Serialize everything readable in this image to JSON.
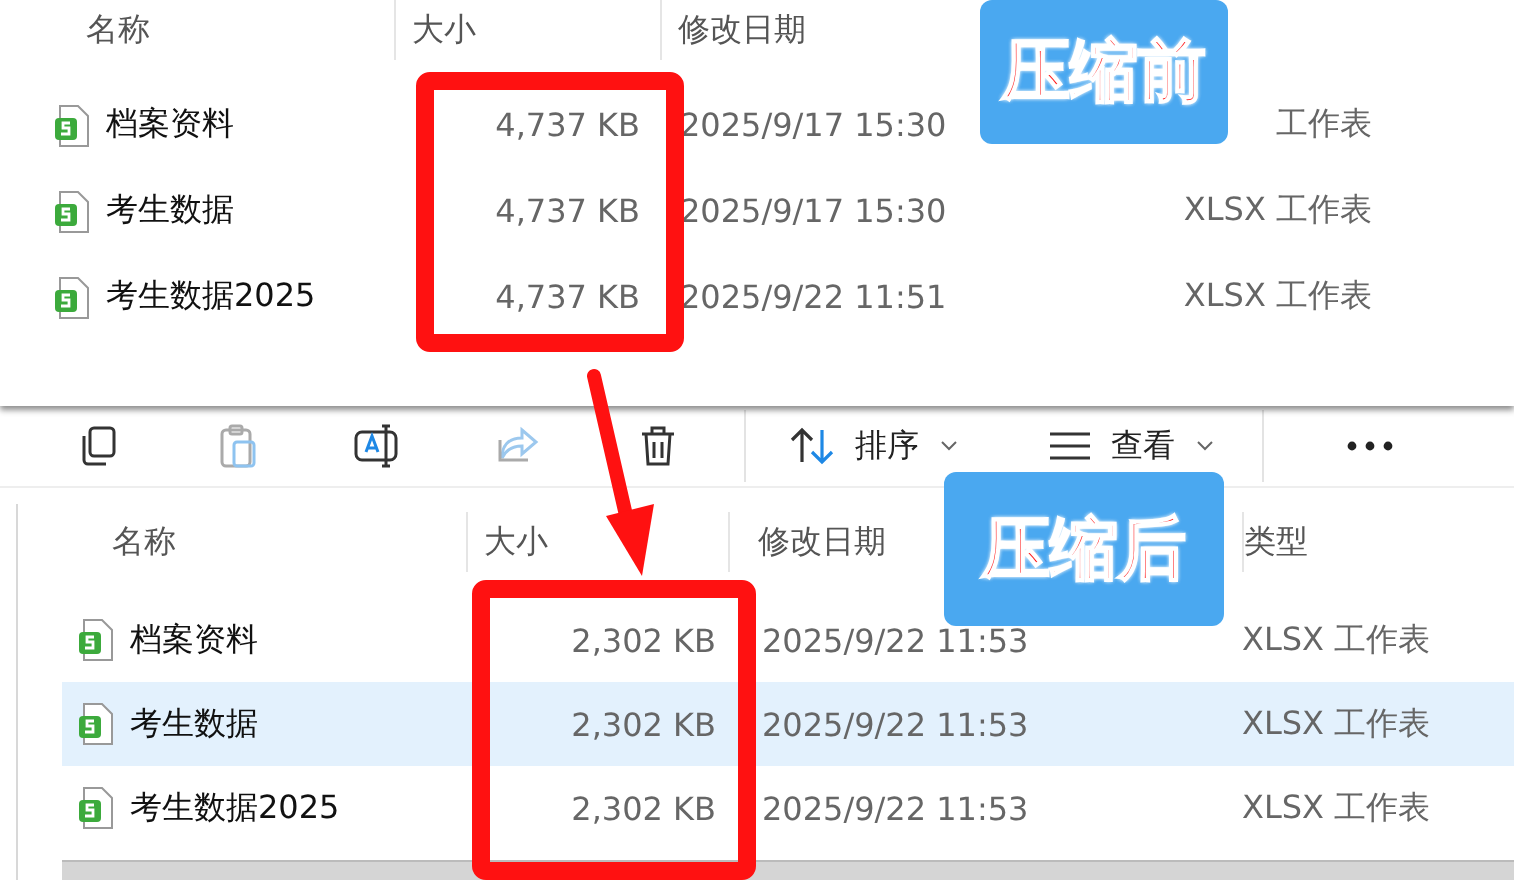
{
  "before": {
    "columns": [
      "名称",
      "大小",
      "修改日期"
    ],
    "rows": [
      {
        "name": "档案资料",
        "size": "4,737 KB",
        "modified": "2025/9/17 15:30",
        "type": "工作表",
        "selected": false
      },
      {
        "name": "考生数据",
        "size": "4,737 KB",
        "modified": "2025/9/17 15:30",
        "type": "XLSX 工作表",
        "selected": false
      },
      {
        "name": "考生数据2025",
        "size": "4,737 KB",
        "modified": "2025/9/22 11:51",
        "type": "XLSX 工作表",
        "selected": false
      }
    ],
    "badge": "压缩前"
  },
  "after": {
    "toolbar": [
      {
        "kind": "copy",
        "disabled": false
      },
      {
        "kind": "paste",
        "disabled": true
      },
      {
        "kind": "rename",
        "disabled": false
      },
      {
        "kind": "share",
        "disabled": true
      },
      {
        "kind": "delete",
        "disabled": false
      },
      {
        "kind": "sort",
        "label": "排序",
        "disabled": false
      },
      {
        "kind": "view",
        "label": "查看",
        "disabled": false
      },
      {
        "kind": "more",
        "disabled": false
      }
    ],
    "columns": [
      "名称",
      "大小",
      "修改日期",
      "类型"
    ],
    "rows": [
      {
        "name": "档案资料",
        "size": "2,302 KB",
        "modified": "2025/9/22 11:53",
        "type": "XLSX 工作表",
        "selected": false
      },
      {
        "name": "考生数据",
        "size": "2,302 KB",
        "modified": "2025/9/22 11:53",
        "type": "XLSX 工作表",
        "selected": true
      },
      {
        "name": "考生数据2025",
        "size": "2,302 KB",
        "modified": "2025/9/22 11:53",
        "type": "XLSX 工作表",
        "selected": false
      }
    ],
    "badge": "压缩后"
  }
}
